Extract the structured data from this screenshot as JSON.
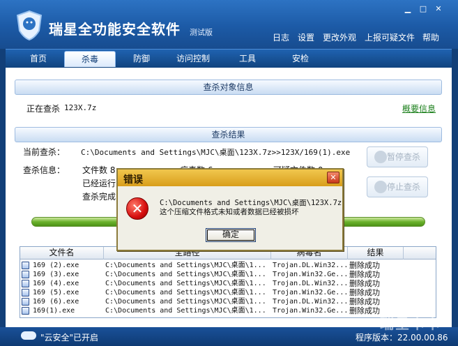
{
  "app": {
    "title": "瑞星全功能安全软件",
    "subtitle": "测试版",
    "top_menu": [
      "日志",
      "设置",
      "更改外观",
      "上报可疑文件",
      "帮助"
    ]
  },
  "nav": {
    "tabs": [
      "首页",
      "杀毒",
      "防御",
      "访问控制",
      "工具",
      "安检"
    ],
    "active_index": 1
  },
  "scan_target": {
    "header": "查杀对象信息",
    "scanning_label": "正在查杀",
    "scanning_value": "123X.7z",
    "summary_link": "概要信息"
  },
  "scan_result": {
    "header": "查杀结果",
    "current_label": "当前查杀：",
    "current_path": "C:\\Documents and Settings\\MJC\\桌面\\123X.7z>>123X/169(1).exe",
    "info_label": "查杀信息：",
    "files_label": "文件数 8",
    "viruses_label": "病毒数 6",
    "suspicious_label": "可疑文件数 0",
    "running_label": "已经运行",
    "complete_label": "查杀完成",
    "pause_button": "暂停查杀",
    "stop_button": "停止查杀"
  },
  "table": {
    "columns": [
      "文件名",
      "全路径",
      "病毒名",
      "结果"
    ],
    "rows": [
      {
        "name": "169 (2).exe",
        "path": "C:\\Documents and Settings\\MJC\\桌面\\1...",
        "virus": "Trojan.DL.Win32...",
        "result": "删除成功"
      },
      {
        "name": "169 (3).exe",
        "path": "C:\\Documents and Settings\\MJC\\桌面\\1...",
        "virus": "Trojan.Win32.Ge...",
        "result": "删除成功"
      },
      {
        "name": "169 (4).exe",
        "path": "C:\\Documents and Settings\\MJC\\桌面\\1...",
        "virus": "Trojan.DL.Win32...",
        "result": "删除成功"
      },
      {
        "name": "169 (5).exe",
        "path": "C:\\Documents and Settings\\MJC\\桌面\\1...",
        "virus": "Trojan.Win32.Ge...",
        "result": "删除成功"
      },
      {
        "name": "169 (6).exe",
        "path": "C:\\Documents and Settings\\MJC\\桌面\\1...",
        "virus": "Trojan.DL.Win32...",
        "result": "删除成功"
      },
      {
        "name": "169(1).exe",
        "path": "C:\\Documents and Settings\\MJC\\桌面\\1...",
        "virus": "Trojan.Win32.Ge...",
        "result": "删除成功"
      }
    ]
  },
  "status": {
    "cloud_label": "\"云安全\"已开启",
    "version_label": "程序版本：22.00.00.86"
  },
  "watermark": "瑞星卡卡",
  "dialog": {
    "title": "错误",
    "message_line1": "C:\\Documents and Settings\\MJC\\桌面\\123X.7z",
    "message_line2": "这个压缩文件格式未知或者数据已经被损坏",
    "ok_button": "确定"
  }
}
